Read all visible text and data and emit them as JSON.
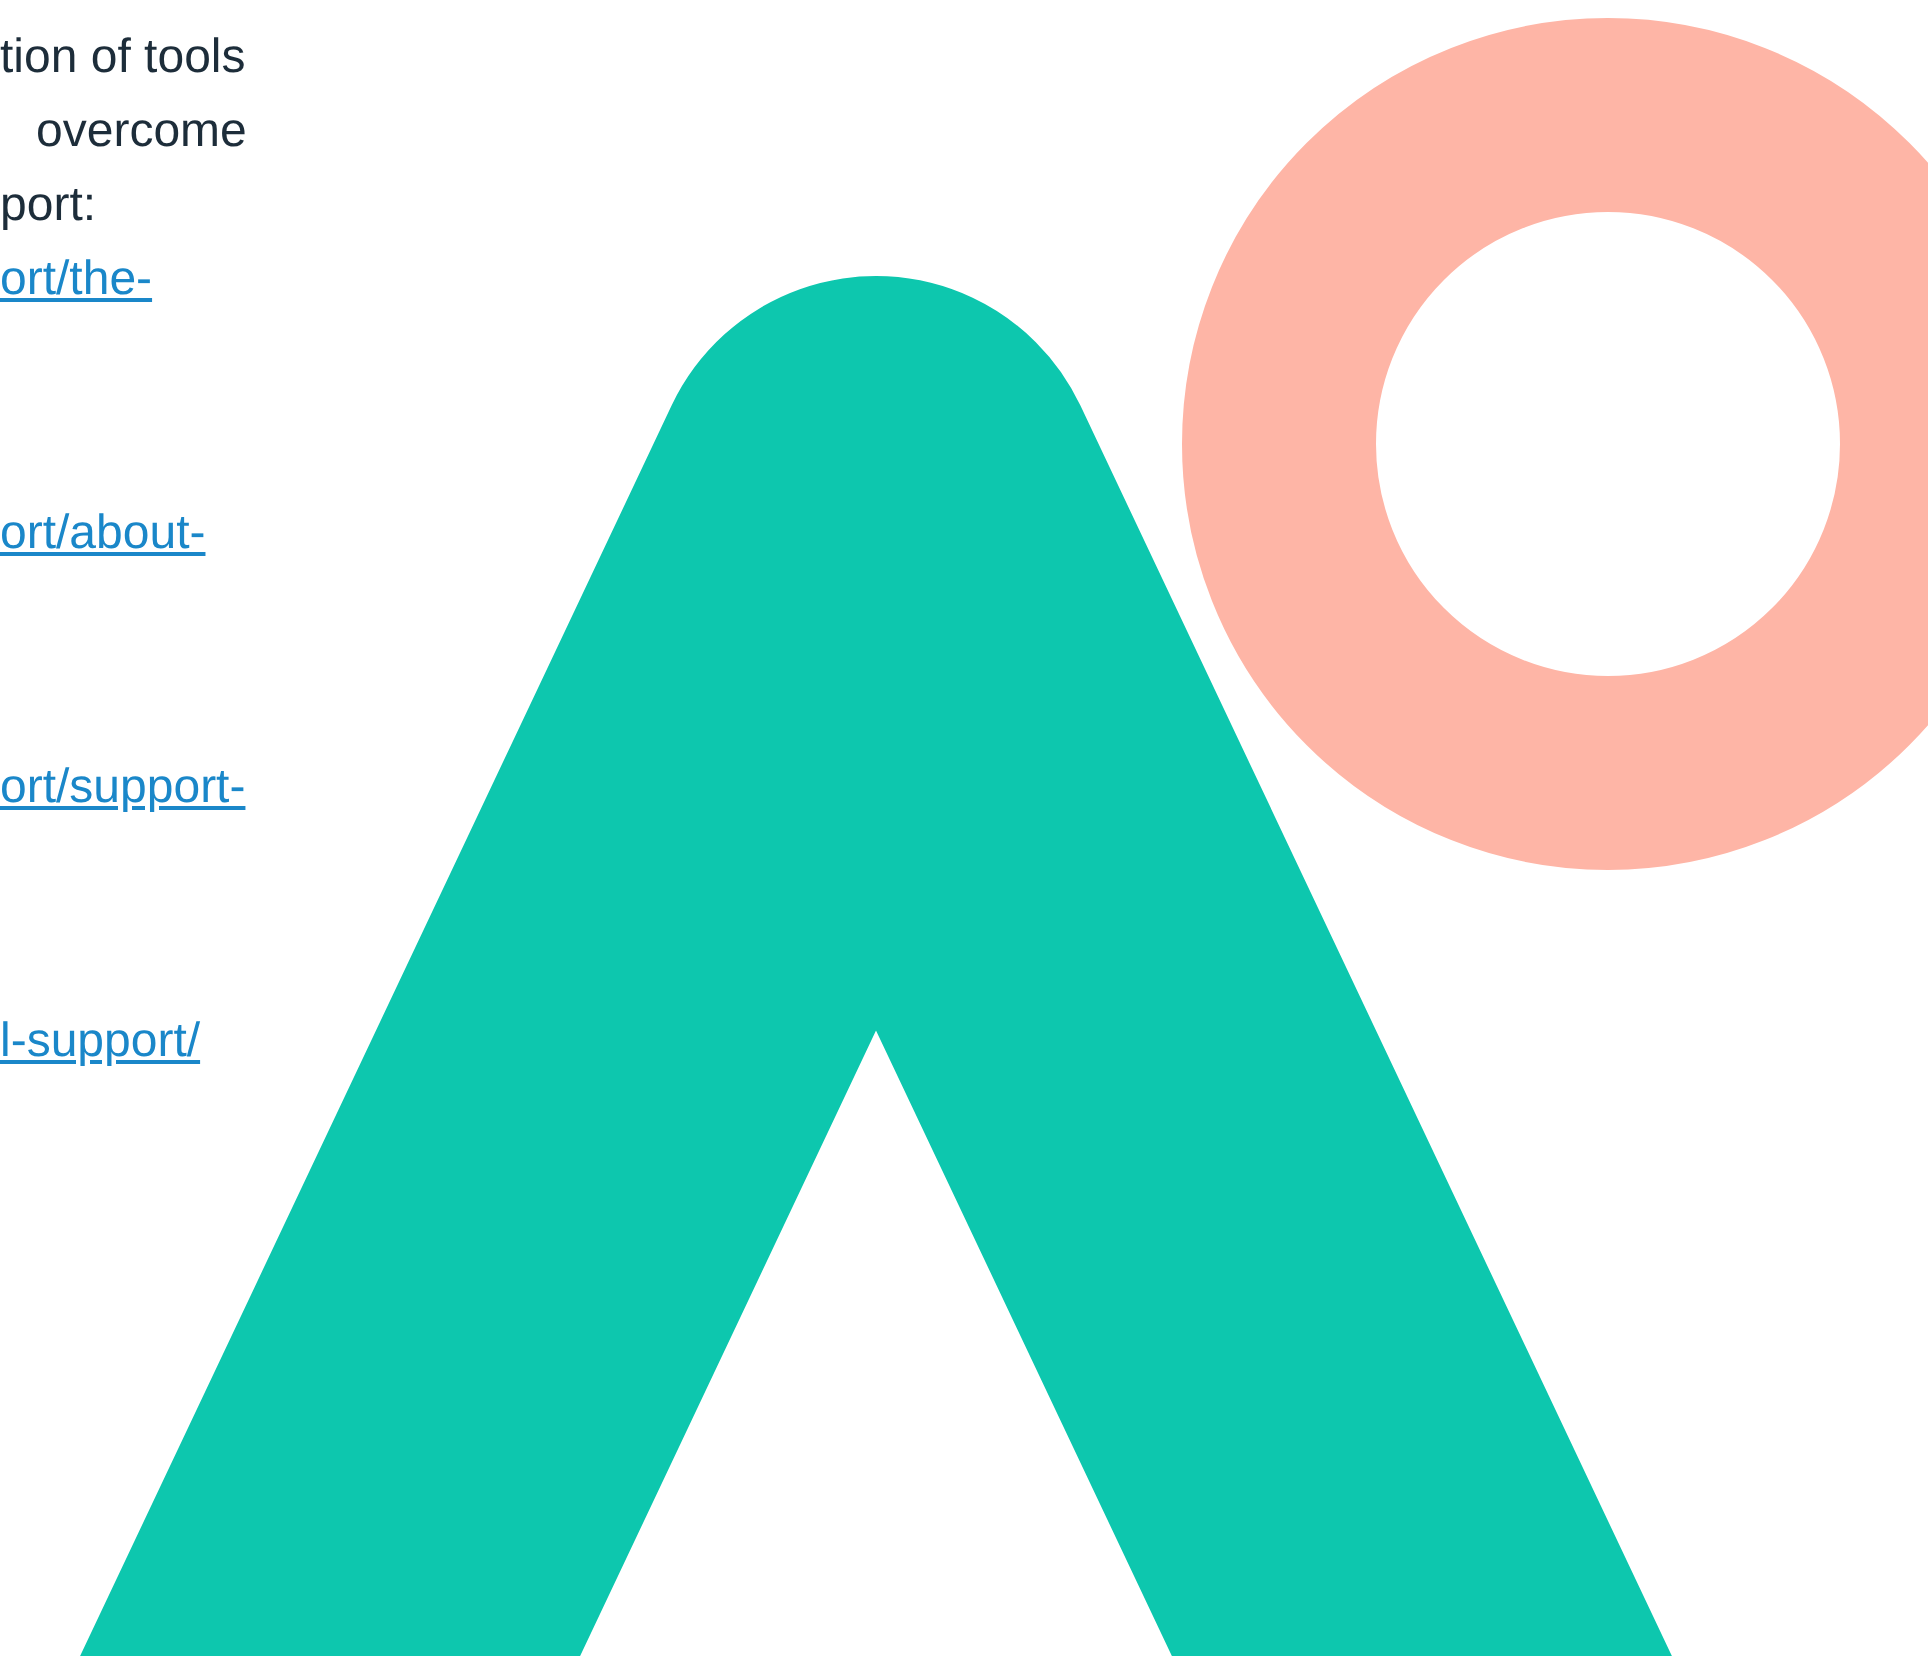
{
  "paragraph_lines": [
    "tion of tools",
    "overcome",
    "port:"
  ],
  "links": [
    "ort/the-",
    "ort/about-",
    "ort/support-",
    "l-support/"
  ]
}
